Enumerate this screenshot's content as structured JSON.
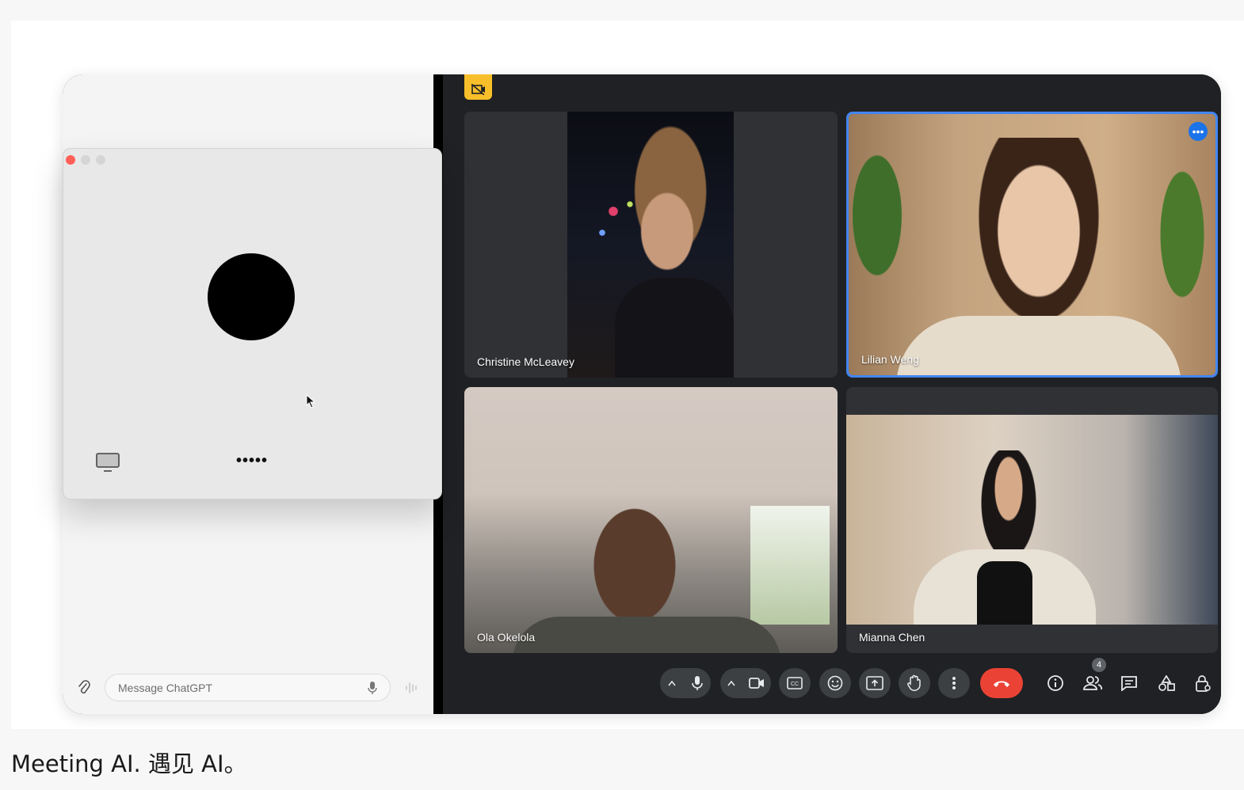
{
  "caption": "Meeting AI. 遇见 AI。",
  "chatgpt": {
    "input_placeholder": "Message ChatGPT",
    "voice_window": {
      "status_dots": "•••••",
      "icons": [
        "screen-share-icon",
        "orb-visual"
      ]
    }
  },
  "meet": {
    "participants": [
      {
        "name": "Christine McLeavey",
        "active": false
      },
      {
        "name": "Lilian Weng",
        "active": true
      },
      {
        "name": "Ola Okelola",
        "active": false
      },
      {
        "name": "Mianna Chen",
        "active": false
      }
    ],
    "people_count": "4",
    "controls": [
      "mic",
      "camera",
      "captions",
      "emoji",
      "present",
      "raise-hand",
      "more-options",
      "end-call",
      "info",
      "people",
      "chat",
      "activities",
      "host-controls"
    ],
    "colors": {
      "end_call": "#ea4335",
      "active_speaker": "#4285f4",
      "recording_badge": "#f9bf2a"
    }
  }
}
